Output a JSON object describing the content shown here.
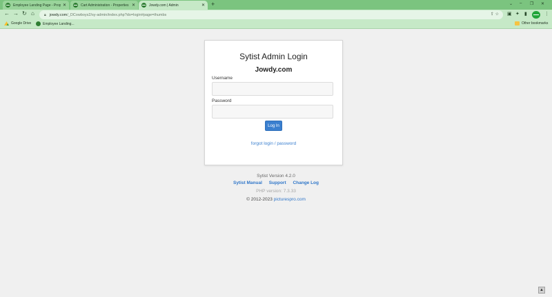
{
  "browser": {
    "tabs": [
      {
        "title": "Employee Landing Page - Propri",
        "active": false
      },
      {
        "title": "Cart Administration - Properties",
        "active": false
      },
      {
        "title": "Jowdy.com | Admin",
        "active": true
      }
    ],
    "new_tab": "+",
    "window_controls": {
      "chevron": "⌄",
      "minimize": "–",
      "restore": "❐",
      "close": "✕"
    },
    "toolbar": {
      "back": "←",
      "forward": "→",
      "reload": "↻",
      "home": "⌂"
    },
    "url_host": "jowdy.com",
    "url_path": "/_DCowboys2/sy-admin/index.php?do=login#page=thumbs",
    "omnibox_icons": "⇪ ☆",
    "extensions": [
      "▣",
      "✦",
      "▮",
      "⋮"
    ],
    "bookmarks": [
      {
        "label": "Google Drive"
      },
      {
        "label": "Employee Landing..."
      }
    ],
    "other_bookmarks": "Other bookmarks"
  },
  "login": {
    "title": "Sytist Admin Login",
    "site": "Jowdy.com",
    "username_label": "Username",
    "username_value": "",
    "password_label": "Password",
    "password_value": "",
    "submit_label": "Log In",
    "forgot_link": "forgot login / password"
  },
  "footer": {
    "version": "Sytist Version 4.2.0",
    "links": [
      "Sytist Manual",
      "Support",
      "Change Log"
    ],
    "php": "PHP version: 7.3.33",
    "copyright_prefix": "© 2012-2023",
    "copyright_link": "picturespro.com"
  },
  "scroll_top": "▲",
  "colors": {
    "chrome": "#c6e9c7",
    "tabstrip": "#7bc47f",
    "accent": "#3a7fcf"
  }
}
